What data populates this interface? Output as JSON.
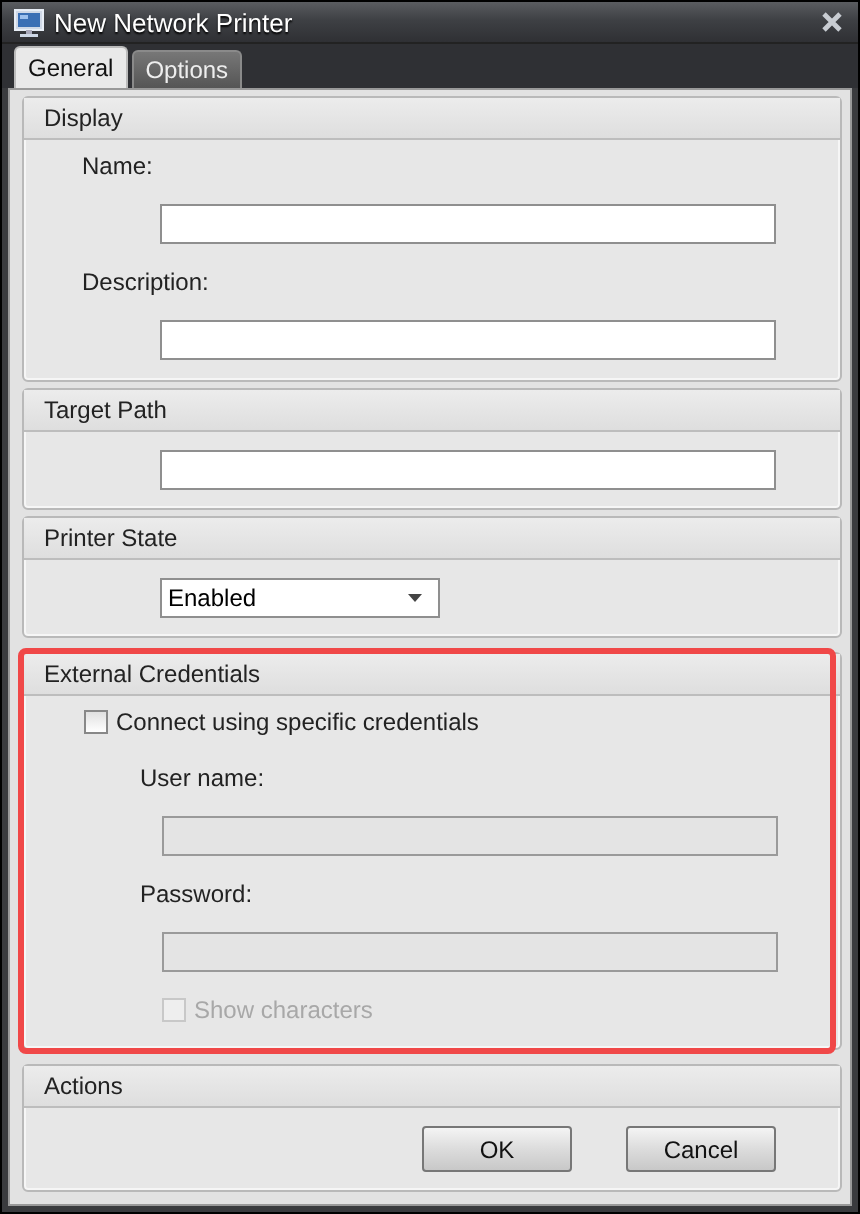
{
  "window": {
    "title": "New Network Printer"
  },
  "tabs": [
    {
      "label": "General",
      "selected": true
    },
    {
      "label": "Options",
      "selected": false
    }
  ],
  "sections": [
    {
      "title": "Display",
      "highlighted": false,
      "rows": [
        {
          "kind": "label",
          "text": "Name:"
        },
        {
          "kind": "field",
          "disabled": false
        },
        {
          "kind": "label",
          "text": "Description:"
        },
        {
          "kind": "field",
          "disabled": false
        }
      ]
    },
    {
      "title": "Target Path",
      "highlighted": false,
      "rows": [
        {
          "kind": "field",
          "disabled": false
        }
      ]
    },
    {
      "title": "Printer State",
      "highlighted": false,
      "rows": [
        {
          "kind": "dropdown",
          "value": "Enabled"
        }
      ]
    },
    {
      "title": "External Credentials",
      "highlighted": true,
      "rows": [
        {
          "kind": "checkbox",
          "label": "Connect using specific credentials",
          "checked": false,
          "disabled": false,
          "children": [
            {
              "kind": "label",
              "text": "User name:"
            },
            {
              "kind": "field",
              "disabled": true
            },
            {
              "kind": "label",
              "text": "Password:"
            },
            {
              "kind": "field",
              "disabled": true
            },
            {
              "kind": "checkbox",
              "label": "Show characters",
              "checked": false,
              "disabled": true
            }
          ]
        }
      ]
    },
    {
      "title": "Actions",
      "highlighted": false,
      "rows": [
        {
          "kind": "buttons",
          "buttons": [
            "OK",
            "Cancel"
          ]
        }
      ]
    }
  ]
}
